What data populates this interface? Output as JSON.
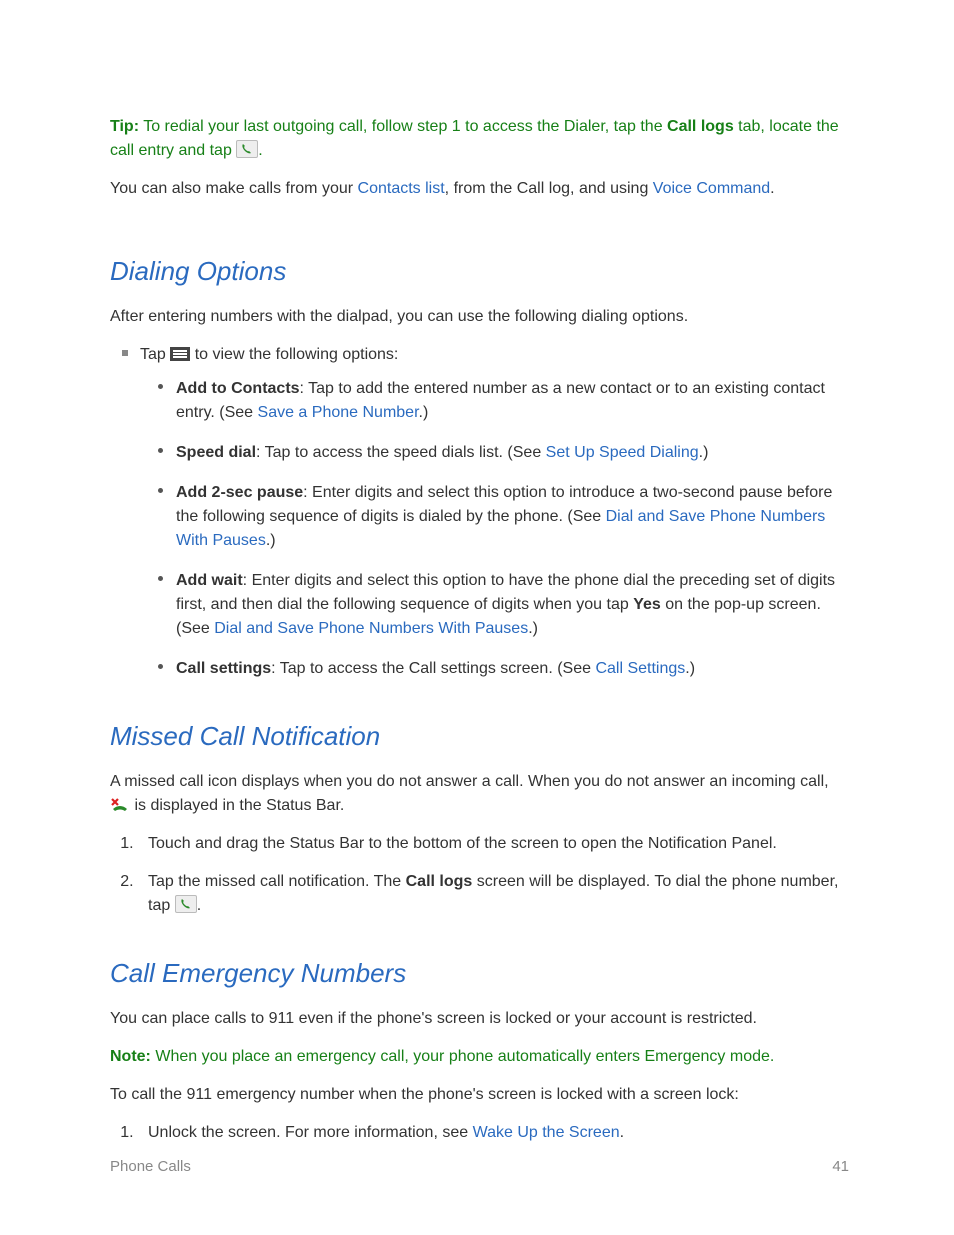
{
  "tip": {
    "label": "Tip:",
    "pre": "To redial your last outgoing call, follow step 1 to access the Dialer, tap the ",
    "bold1": "Call logs",
    "mid": " tab, locate the call entry and tap ",
    "post": "."
  },
  "intro": {
    "pre": "You can also make calls from your ",
    "link1": "Contacts list",
    "mid": ", from the Call log, and using ",
    "link2": "Voice Command",
    "post": "."
  },
  "sections": {
    "dialing": {
      "heading": "Dialing Options",
      "lead": "After entering numbers with the dialpad, you can use the following dialing options.",
      "tap_pre": "Tap ",
      "tap_post": " to view the following options:",
      "items": {
        "addContacts": {
          "bold": "Add to Contacts",
          "text": ": Tap to add the entered number as a new contact or to an existing contact entry. (See ",
          "link": "Save a Phone Number",
          "post": ".)"
        },
        "speedDial": {
          "bold": "Speed dial",
          "text": ": Tap to access the speed dials list. (See ",
          "link": "Set Up Speed Dialing",
          "post": ".)"
        },
        "pause2sec": {
          "bold": "Add 2-sec pause",
          "text": ": Enter digits and select this option to introduce a two-second pause before the following sequence of digits is dialed by the phone. (See ",
          "link": "Dial and Save Phone Numbers With Pauses",
          "post": ".)"
        },
        "addWait": {
          "bold": "Add wait",
          "text1": ": Enter digits and select this option to have the phone dial the preceding set of digits first, and then dial the following sequence of digits when you tap ",
          "yes": "Yes",
          "text2": " on the pop-up screen. (See ",
          "link": "Dial and Save Phone Numbers With Pauses",
          "post": ".)"
        },
        "callSettings": {
          "bold": "Call settings",
          "text": ": Tap to access the Call settings screen. (See ",
          "link": "Call Settings",
          "post": ".)"
        }
      }
    },
    "missed": {
      "heading": "Missed Call Notification",
      "lead_pre": "A missed call icon displays when you do not answer a call. When you do not answer an incoming call, ",
      "lead_post": " is displayed in the Status Bar.",
      "steps": {
        "s1": "Touch and drag the Status Bar to the bottom of the screen to open the Notification Panel.",
        "s2_pre": "Tap the missed call notification. The ",
        "s2_bold": "Call logs",
        "s2_mid": " screen will be displayed. To dial the phone number, tap ",
        "s2_post": "."
      }
    },
    "emergency": {
      "heading": "Call Emergency Numbers",
      "lead": "You can place calls to 911 even if the phone's screen is locked or your account is restricted.",
      "note_label": "Note:",
      "note_text": "When you place an emergency call, your phone automatically enters Emergency mode.",
      "body": "To call the 911 emergency number when the phone's screen is locked with a screen lock:",
      "step1_pre": "Unlock the screen. For more information, see ",
      "step1_link": "Wake Up the Screen",
      "step1_post": "."
    }
  },
  "footer": {
    "section": "Phone Calls",
    "page": "41"
  }
}
